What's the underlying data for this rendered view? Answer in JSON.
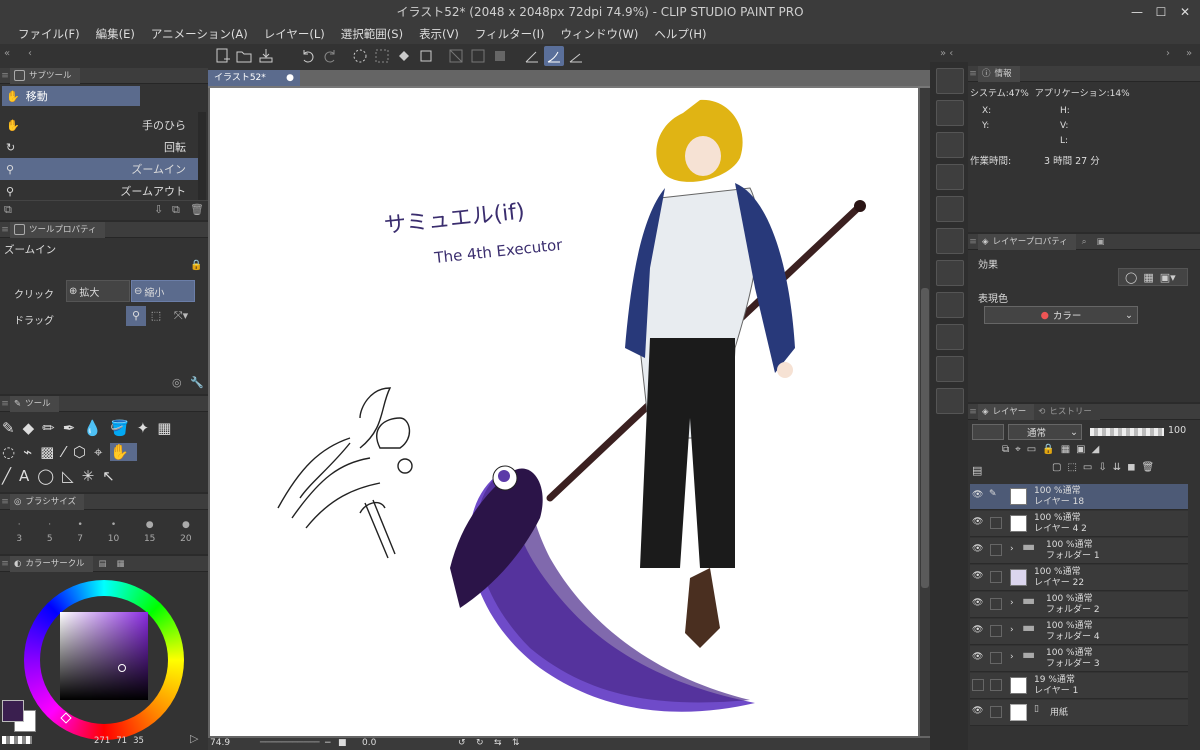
{
  "window": {
    "title": "イラスト52* (2048 x 2048px 72dpi 74.9%) - CLIP STUDIO PAINT PRO"
  },
  "menu": [
    "ファイル(F)",
    "編集(E)",
    "アニメーション(A)",
    "レイヤー(L)",
    "選択範囲(S)",
    "表示(V)",
    "フィルター(I)",
    "ウィンドウ(W)",
    "ヘルプ(H)"
  ],
  "subtool": {
    "tab": "サブツール",
    "group": "移動",
    "items": [
      {
        "label": "手のひら",
        "icon": "hand-icon"
      },
      {
        "label": "回転",
        "icon": "rotate-icon"
      },
      {
        "label": "ズームイン",
        "icon": "zoom-in-icon"
      },
      {
        "label": "ズームアウト",
        "icon": "zoom-out-icon"
      }
    ]
  },
  "toolprop": {
    "tab": "ツールプロパティ",
    "name": "ズームイン",
    "click_label": "クリック",
    "zoom_in_label": "拡大",
    "zoom_out_label": "縮小",
    "drag_label": "ドラッグ"
  },
  "tools": {
    "tab": "ツール"
  },
  "brushsize": {
    "tab": "ブラシサイズ",
    "sizes": [
      "3",
      "5",
      "7",
      "10",
      "15",
      "20"
    ]
  },
  "color": {
    "tab": "カラーサークル",
    "hsv": [
      "271",
      "71",
      "35"
    ],
    "main_color": "#3a1f4f"
  },
  "document": {
    "tab": "イラスト52*"
  },
  "canvas": {
    "title_text": "サミュエル(if)",
    "subtitle_text": "The 4th Executor"
  },
  "status": {
    "zoom": "74.9",
    "angle": "0.0"
  },
  "info": {
    "tab": "情報",
    "system": "システム:47%",
    "app": "アプリケーション:14%",
    "x_label": "X:",
    "y_label": "Y:",
    "h_label": "H:",
    "v_label": "V:",
    "l_label": "L:",
    "work_time_label": "作業時間:",
    "work_time": "3 時間 27 分"
  },
  "layerprop": {
    "tab": "レイヤープロパティ",
    "effect_label": "効果",
    "expr_label": "表現色",
    "expr_value": "カラー"
  },
  "layerpanel": {
    "tab_layer": "レイヤー",
    "tab_history": "ヒストリー",
    "blend": "通常",
    "opacity": "100",
    "layers": [
      {
        "mode": "100 %通常",
        "name": "レイヤー 18",
        "type": "layer",
        "selected": true
      },
      {
        "mode": "100 %通常",
        "name": "レイヤー 4 2",
        "type": "layer"
      },
      {
        "mode": "100 %通常",
        "name": "フォルダー 1",
        "type": "folder"
      },
      {
        "mode": "100 %通常",
        "name": "レイヤー 22",
        "type": "layer"
      },
      {
        "mode": "100 %通常",
        "name": "フォルダー 2",
        "type": "folder"
      },
      {
        "mode": "100 %通常",
        "name": "フォルダー 4",
        "type": "folder"
      },
      {
        "mode": "100 %通常",
        "name": "フォルダー 3",
        "type": "folder"
      },
      {
        "mode": "19 %通常",
        "name": "レイヤー 1",
        "type": "layer"
      },
      {
        "mode": "",
        "name": "用紙",
        "type": "paper"
      }
    ]
  }
}
